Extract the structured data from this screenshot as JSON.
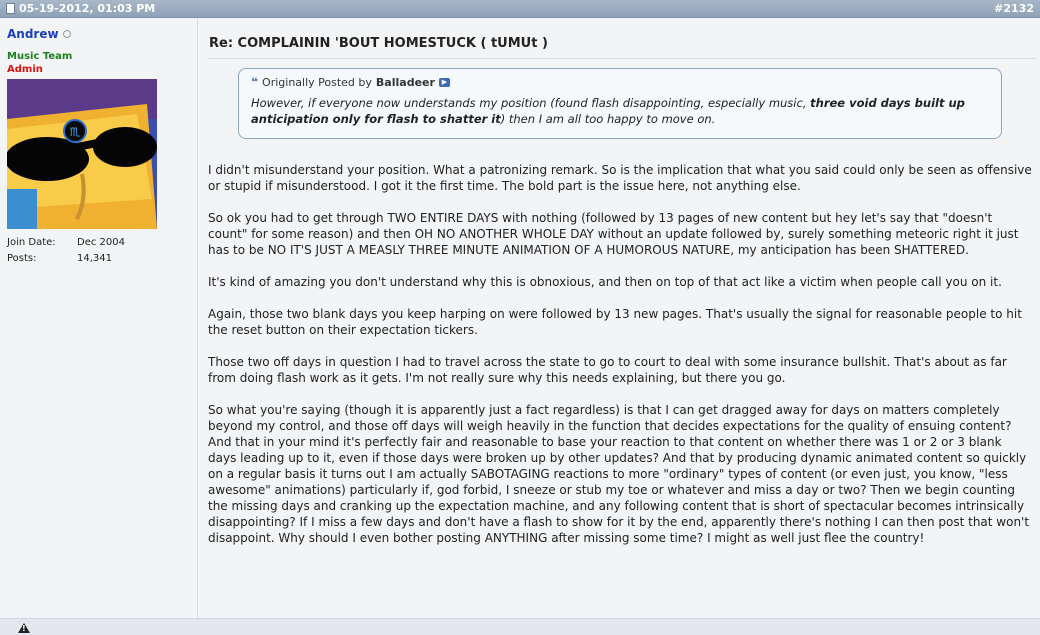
{
  "post": {
    "date": "05-19-2012, 01:03 PM",
    "number": "#2132",
    "title": "Re: COMPLAININ 'BOUT HOMESTUCK ( tUMUt )"
  },
  "user": {
    "name": "Andrew",
    "team": "Music Team",
    "rank": "Admin",
    "join_label": "Join Date:",
    "join_value": "Dec 2004",
    "posts_label": "Posts:",
    "posts_value": "14,341"
  },
  "quote": {
    "prefix": "Originally Posted by",
    "author": "Balladeer",
    "text_before": "However, if everyone now understands my position (found flash disappointing, especially music, ",
    "text_bold": "three void days built up anticipation only for flash to shatter it",
    "text_after": ") then I am all too happy to move on."
  },
  "paragraphs": [
    "I didn't misunderstand your position. What a patronizing remark. So is the implication that what you said could only be seen as offensive or stupid if misunderstood. I got it the first time. The bold part is the issue here, not anything else.",
    "So ok you had to get through TWO ENTIRE DAYS with nothing (followed by 13 pages of new content but hey let's say that \"doesn't count\" for some reason) and then OH NO ANOTHER WHOLE DAY without an update followed by, surely something meteoric right it just has to be NO IT'S JUST A MEASLY THREE MINUTE ANIMATION OF A HUMOROUS NATURE, my anticipation has been SHATTERED.",
    "It's kind of amazing you don't understand why this is obnoxious, and then on top of that act like a victim when people call you on it.",
    "Again, those two blank days you keep harping on were followed by 13 new pages. That's usually the signal for reasonable people to hit the reset button on their expectation tickers.",
    "Those two off days in question I had to travel across the state to go to court to deal with some insurance bullshit. That's about as far from doing flash work as it gets. I'm not really sure why this needs explaining, but there you go.",
    "So what you're saying (though it is apparently just a fact regardless) is that I can get dragged away for days on matters completely beyond my control, and those off days will weigh heavily in the function that decides expectations for the quality of ensuing content? And that in your mind it's perfectly fair and reasonable to base your reaction to that content on whether there was 1 or 2 or 3 blank days leading up to it, even if those days were broken up by other updates? And that by producing dynamic animated content so quickly on a regular basis it turns out I am actually SABOTAGING reactions to more \"ordinary\" types of content (or even just, you know, \"less awesome\" animations) particularly if, god forbid, I sneeze or stub my toe or whatever and miss a day or two? Then we begin counting the missing days and cranking up the expectation machine, and any following content that is short of spectacular becomes intrinsically disappointing? If I miss a few days and don't have a flash to show for it by the end, apparently there's nothing I can then post that won't disappoint. Why should I even bother posting ANYTHING after missing some time? I might as well just flee the country!"
  ],
  "colors": {
    "header_bar": "#94a7bc",
    "username": "#1d3fb8",
    "team": "#1f7f1f",
    "rank": "#dd1111",
    "quote_border": "#8fa7c4"
  }
}
